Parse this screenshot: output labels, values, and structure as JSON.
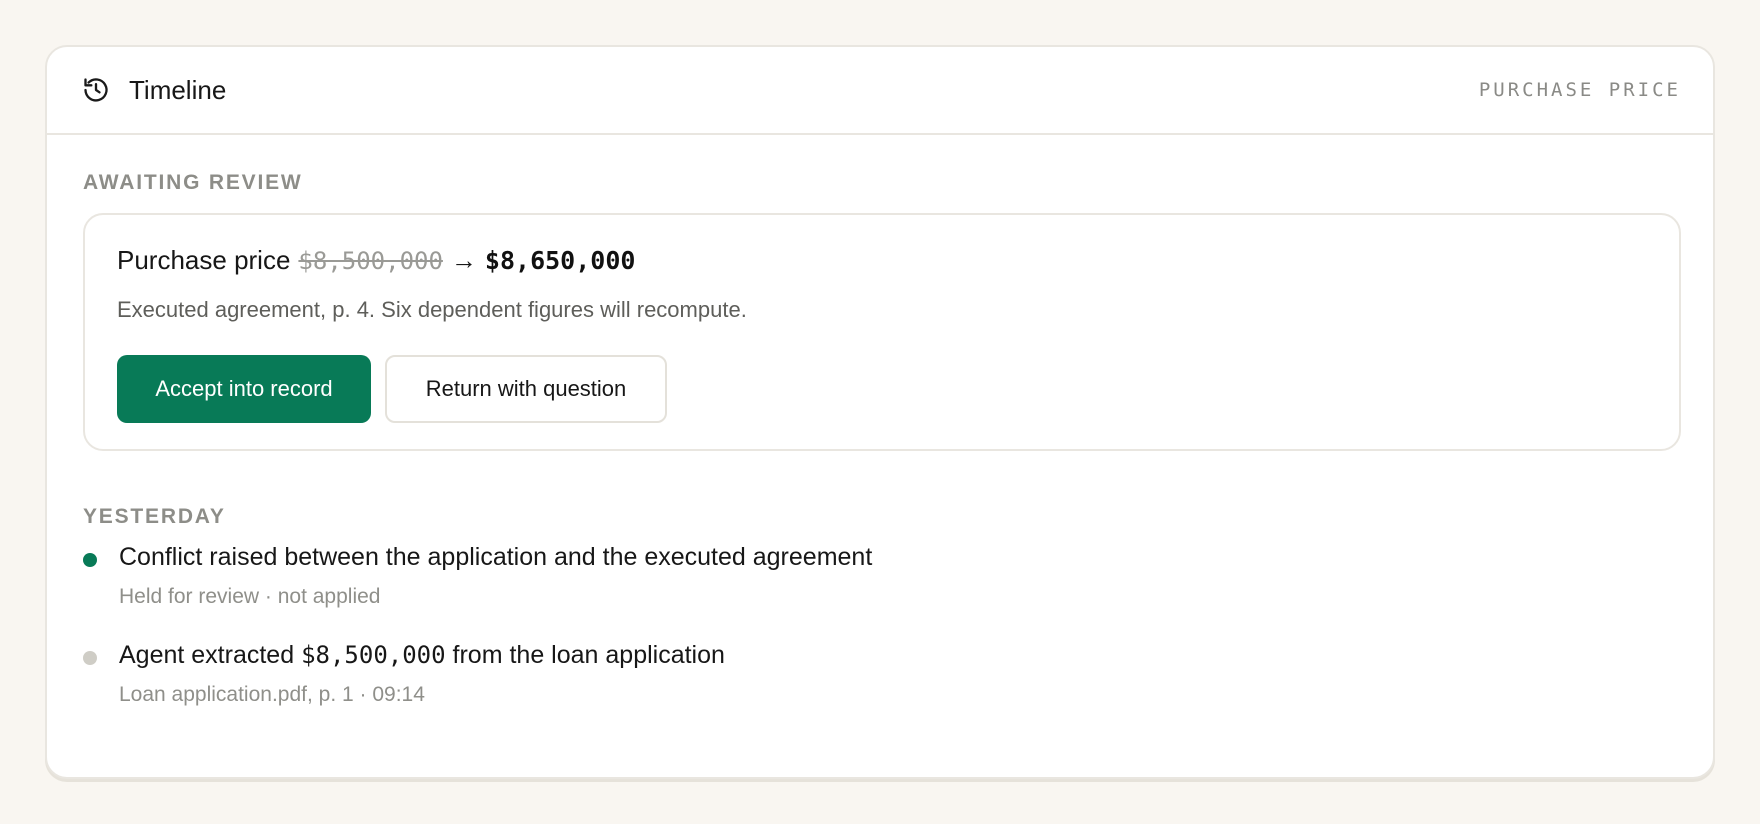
{
  "header": {
    "title": "Timeline",
    "icon": "history-icon",
    "tag": "PURCHASE PRICE"
  },
  "review": {
    "section_label": "AWAITING REVIEW",
    "field_label": "Purchase price",
    "old_value": "$8,500,000",
    "arrow": "→",
    "new_value": "$8,650,000",
    "note": "Executed agreement, p. 4. Six dependent figures will recompute.",
    "accept_label": "Accept into record",
    "return_label": "Return with question"
  },
  "history": {
    "section_label": "YESTERDAY",
    "events": [
      {
        "title": "Conflict raised between the application and the executed agreement",
        "subtitle": "Held for review · not applied",
        "dot_color": "#087a57"
      },
      {
        "title_prefix": "Agent extracted",
        "title_value": "$8,500,000",
        "title_suffix": "from the loan application",
        "subtitle": "Loan application.pdf, p. 1 · 09:14",
        "dot_color": "#cfcdc6"
      }
    ]
  },
  "colors": {
    "accent": "#087a57",
    "background": "#f9f6f1"
  }
}
